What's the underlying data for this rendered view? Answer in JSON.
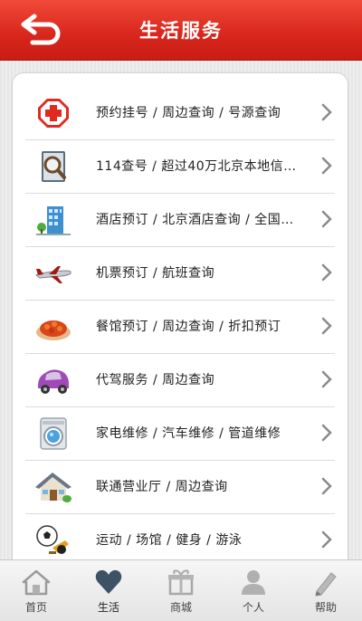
{
  "header": {
    "title": "生活服务"
  },
  "services": [
    {
      "label": "预约挂号 / 周边查询 / 号源查询",
      "icon": "hospital-cross-icon"
    },
    {
      "label": "114查号 / 超过40万北京本地信…",
      "icon": "magnifier-directory-icon"
    },
    {
      "label": "酒店预订 / 北京酒店查询 / 全国…",
      "icon": "hotel-building-icon"
    },
    {
      "label": "机票预订 / 航班查询",
      "icon": "airplane-icon"
    },
    {
      "label": "餐馆预订 / 周边查询 / 折扣预订",
      "icon": "food-dish-icon"
    },
    {
      "label": "代驾服务 / 周边查询",
      "icon": "car-icon"
    },
    {
      "label": "家电维修 / 汽车维修 / 管道维修",
      "icon": "washing-machine-icon"
    },
    {
      "label": "联通营业厅 / 周边查询",
      "icon": "house-icon"
    },
    {
      "label": "运动 / 场馆 / 健身 / 游泳",
      "icon": "sports-ball-icon"
    }
  ],
  "tabs": [
    {
      "label": "首页",
      "icon": "home-icon",
      "active": false
    },
    {
      "label": "生活",
      "icon": "heart-icon",
      "active": true
    },
    {
      "label": "商城",
      "icon": "gift-icon",
      "active": false
    },
    {
      "label": "个人",
      "icon": "person-icon",
      "active": false
    },
    {
      "label": "帮助",
      "icon": "pencil-icon",
      "active": false
    }
  ]
}
